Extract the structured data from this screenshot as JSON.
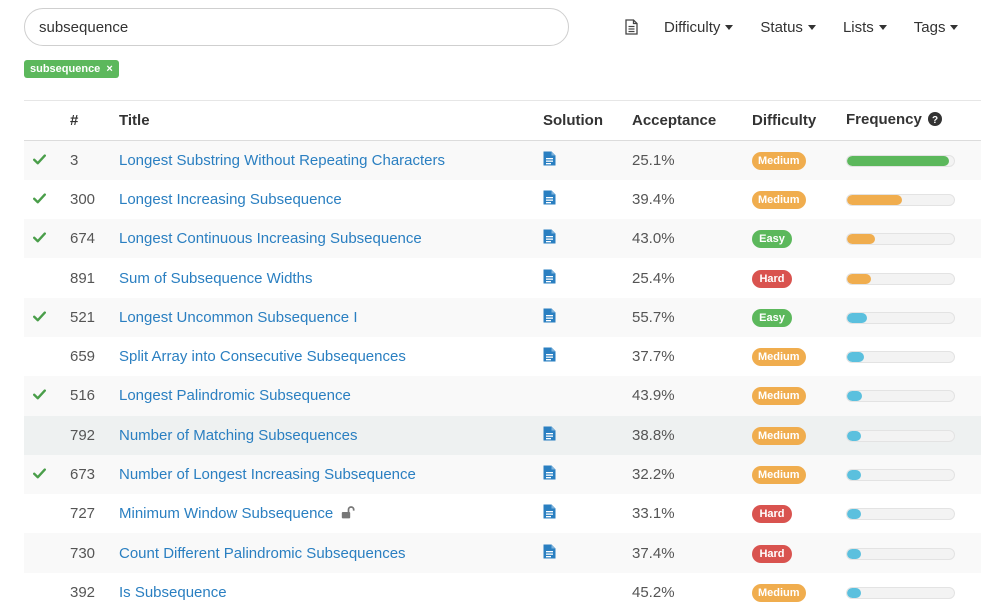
{
  "search": {
    "value": "subsequence"
  },
  "toolbar": {
    "doc_icon": "document-icon",
    "filters": [
      "Difficulty",
      "Status",
      "Lists",
      "Tags"
    ]
  },
  "active_tag": {
    "label": "subsequence",
    "remove": "×"
  },
  "table": {
    "headers": {
      "num": "#",
      "title": "Title",
      "solution": "Solution",
      "acceptance": "Acceptance",
      "difficulty": "Difficulty",
      "frequency": "Frequency"
    },
    "rows": [
      {
        "solved": true,
        "num": "3",
        "title": "Longest Substring Without Repeating Characters",
        "locked": false,
        "solution": true,
        "acceptance": "25.1%",
        "difficulty": "Medium",
        "frequency": 0.95,
        "freq_color": "#5cb85c"
      },
      {
        "solved": true,
        "num": "300",
        "title": "Longest Increasing Subsequence",
        "locked": false,
        "solution": true,
        "acceptance": "39.4%",
        "difficulty": "Medium",
        "frequency": 0.51,
        "freq_color": "#f0ad4e"
      },
      {
        "solved": true,
        "num": "674",
        "title": "Longest Continuous Increasing Subsequence",
        "locked": false,
        "solution": true,
        "acceptance": "43.0%",
        "difficulty": "Easy",
        "frequency": 0.26,
        "freq_color": "#f0ad4e"
      },
      {
        "solved": false,
        "num": "891",
        "title": "Sum of Subsequence Widths",
        "locked": false,
        "solution": true,
        "acceptance": "25.4%",
        "difficulty": "Hard",
        "frequency": 0.22,
        "freq_color": "#f0ad4e"
      },
      {
        "solved": true,
        "num": "521",
        "title": "Longest Uncommon Subsequence I",
        "locked": false,
        "solution": true,
        "acceptance": "55.7%",
        "difficulty": "Easy",
        "frequency": 0.19,
        "freq_color": "#5bc0de"
      },
      {
        "solved": false,
        "num": "659",
        "title": "Split Array into Consecutive Subsequences",
        "locked": false,
        "solution": true,
        "acceptance": "37.7%",
        "difficulty": "Medium",
        "frequency": 0.16,
        "freq_color": "#5bc0de"
      },
      {
        "solved": true,
        "num": "516",
        "title": "Longest Palindromic Subsequence",
        "locked": false,
        "solution": false,
        "acceptance": "43.9%",
        "difficulty": "Medium",
        "frequency": 0.14,
        "freq_color": "#5bc0de"
      },
      {
        "solved": false,
        "num": "792",
        "title": "Number of Matching Subsequences",
        "locked": false,
        "solution": true,
        "acceptance": "38.8%",
        "difficulty": "Medium",
        "frequency": 0.13,
        "freq_color": "#5bc0de"
      },
      {
        "solved": true,
        "num": "673",
        "title": "Number of Longest Increasing Subsequence",
        "locked": false,
        "solution": true,
        "acceptance": "32.2%",
        "difficulty": "Medium",
        "frequency": 0.13,
        "freq_color": "#5bc0de"
      },
      {
        "solved": false,
        "num": "727",
        "title": "Minimum Window Subsequence",
        "locked": true,
        "solution": true,
        "acceptance": "33.1%",
        "difficulty": "Hard",
        "frequency": 0.13,
        "freq_color": "#5bc0de"
      },
      {
        "solved": false,
        "num": "730",
        "title": "Count Different Palindromic Subsequences",
        "locked": false,
        "solution": true,
        "acceptance": "37.4%",
        "difficulty": "Hard",
        "frequency": 0.13,
        "freq_color": "#5bc0de"
      },
      {
        "solved": false,
        "num": "392",
        "title": "Is Subsequence",
        "locked": false,
        "solution": false,
        "acceptance": "45.2%",
        "difficulty": "Medium",
        "frequency": 0.13,
        "freq_color": "#5bc0de"
      }
    ]
  }
}
